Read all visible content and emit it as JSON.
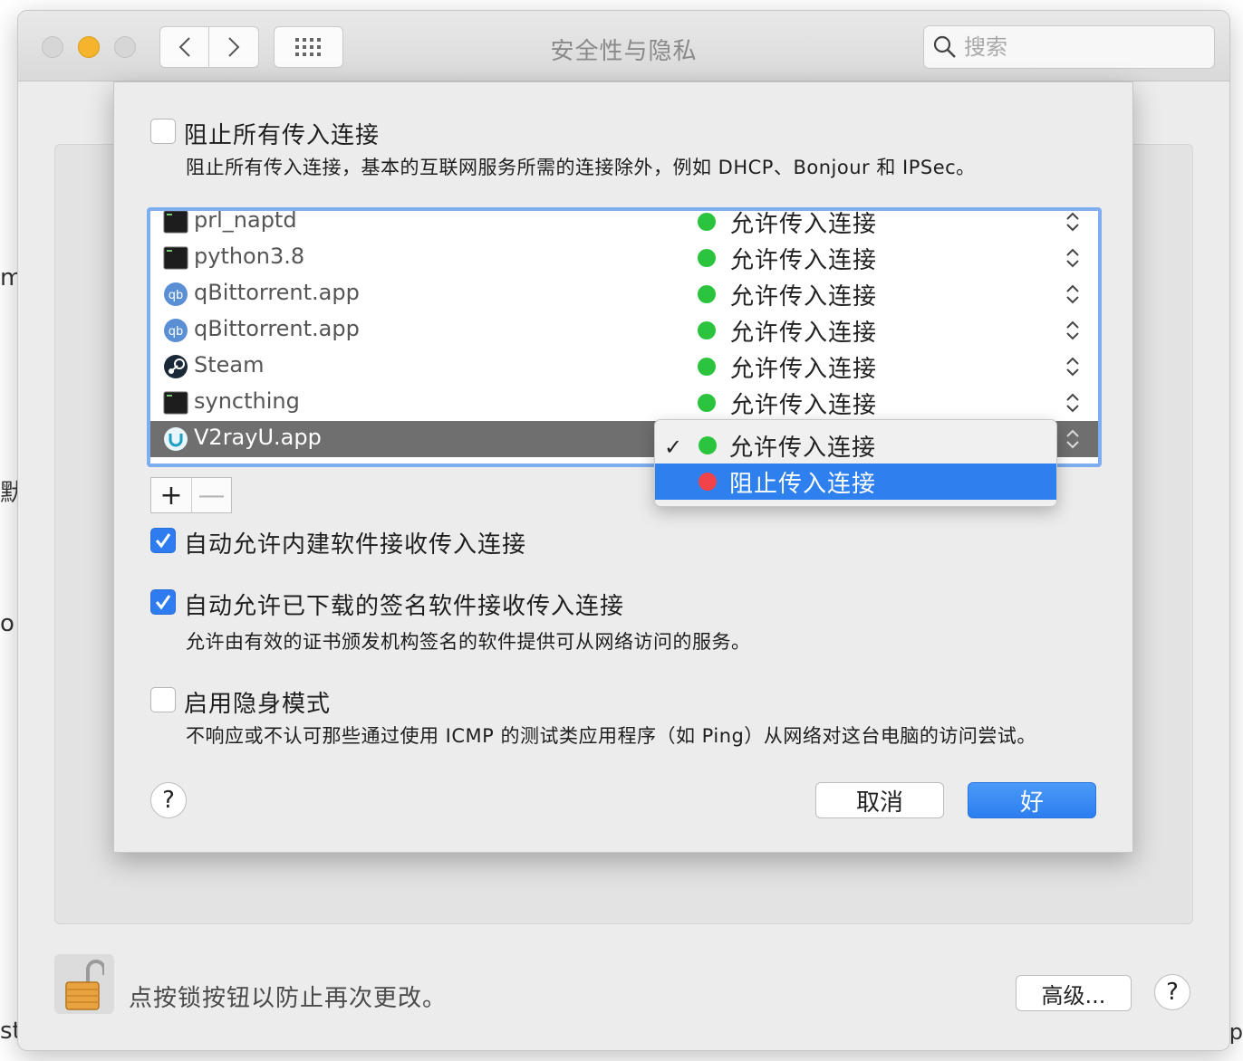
{
  "window": {
    "title": "安全性与隐私",
    "search_placeholder": "搜索"
  },
  "background_fragments": {
    "left": [
      "m",
      "默",
      "o",
      "st"
    ],
    "right": [
      "p"
    ]
  },
  "firewall_options": {
    "block_all": {
      "label": "阻止所有传入连接",
      "description": "阻止所有传入连接，基本的互联网服务所需的连接除外，例如 DHCP、Bonjour 和 IPSec。",
      "checked": false
    },
    "auto_builtin": {
      "label": "自动允许内建软件接收传入连接",
      "checked": true
    },
    "auto_signed": {
      "label": "自动允许已下载的签名软件接收传入连接",
      "description": "允许由有效的证书颁发机构签名的软件提供可从网络访问的服务。",
      "checked": true
    },
    "stealth": {
      "label": "启用隐身模式",
      "description": "不响应或不认可那些通过使用 ICMP 的测试类应用程序（如 Ping）从网络对这台电脑的访问尝试。",
      "checked": false
    }
  },
  "apps": [
    {
      "name": "prl_naptd",
      "icon": "terminal-icon",
      "status": "允许传入连接"
    },
    {
      "name": "python3.8",
      "icon": "terminal-icon",
      "status": "允许传入连接"
    },
    {
      "name": "qBittorrent.app",
      "icon": "qbittorrent-icon",
      "status": "允许传入连接"
    },
    {
      "name": "qBittorrent.app",
      "icon": "qbittorrent-icon",
      "status": "允许传入连接"
    },
    {
      "name": "Steam",
      "icon": "steam-icon",
      "status": "允许传入连接"
    },
    {
      "name": "syncthing",
      "icon": "terminal-icon",
      "status": "允许传入连接"
    },
    {
      "name": "V2rayU.app",
      "icon": "v2rayu-icon",
      "status": "允许传入连接",
      "selected": true
    }
  ],
  "list_controls": {
    "add": "+",
    "remove": "—"
  },
  "popup_menu": {
    "items": [
      {
        "label": "允许传入连接",
        "checked": true,
        "color": "#2ac43e",
        "highlighted": false
      },
      {
        "label": "阻止传入连接",
        "checked": false,
        "color": "#f2424a",
        "highlighted": true
      }
    ],
    "check_mark": "✓"
  },
  "sheet_buttons": {
    "help": "?",
    "cancel": "取消",
    "ok": "好"
  },
  "bottom": {
    "lock_text": "点按锁按钮以防止再次更改。",
    "advanced": "高级...",
    "help": "?"
  },
  "colors": {
    "accent": "#2e7cf0",
    "allow": "#2ac43e",
    "block": "#f2424a"
  }
}
